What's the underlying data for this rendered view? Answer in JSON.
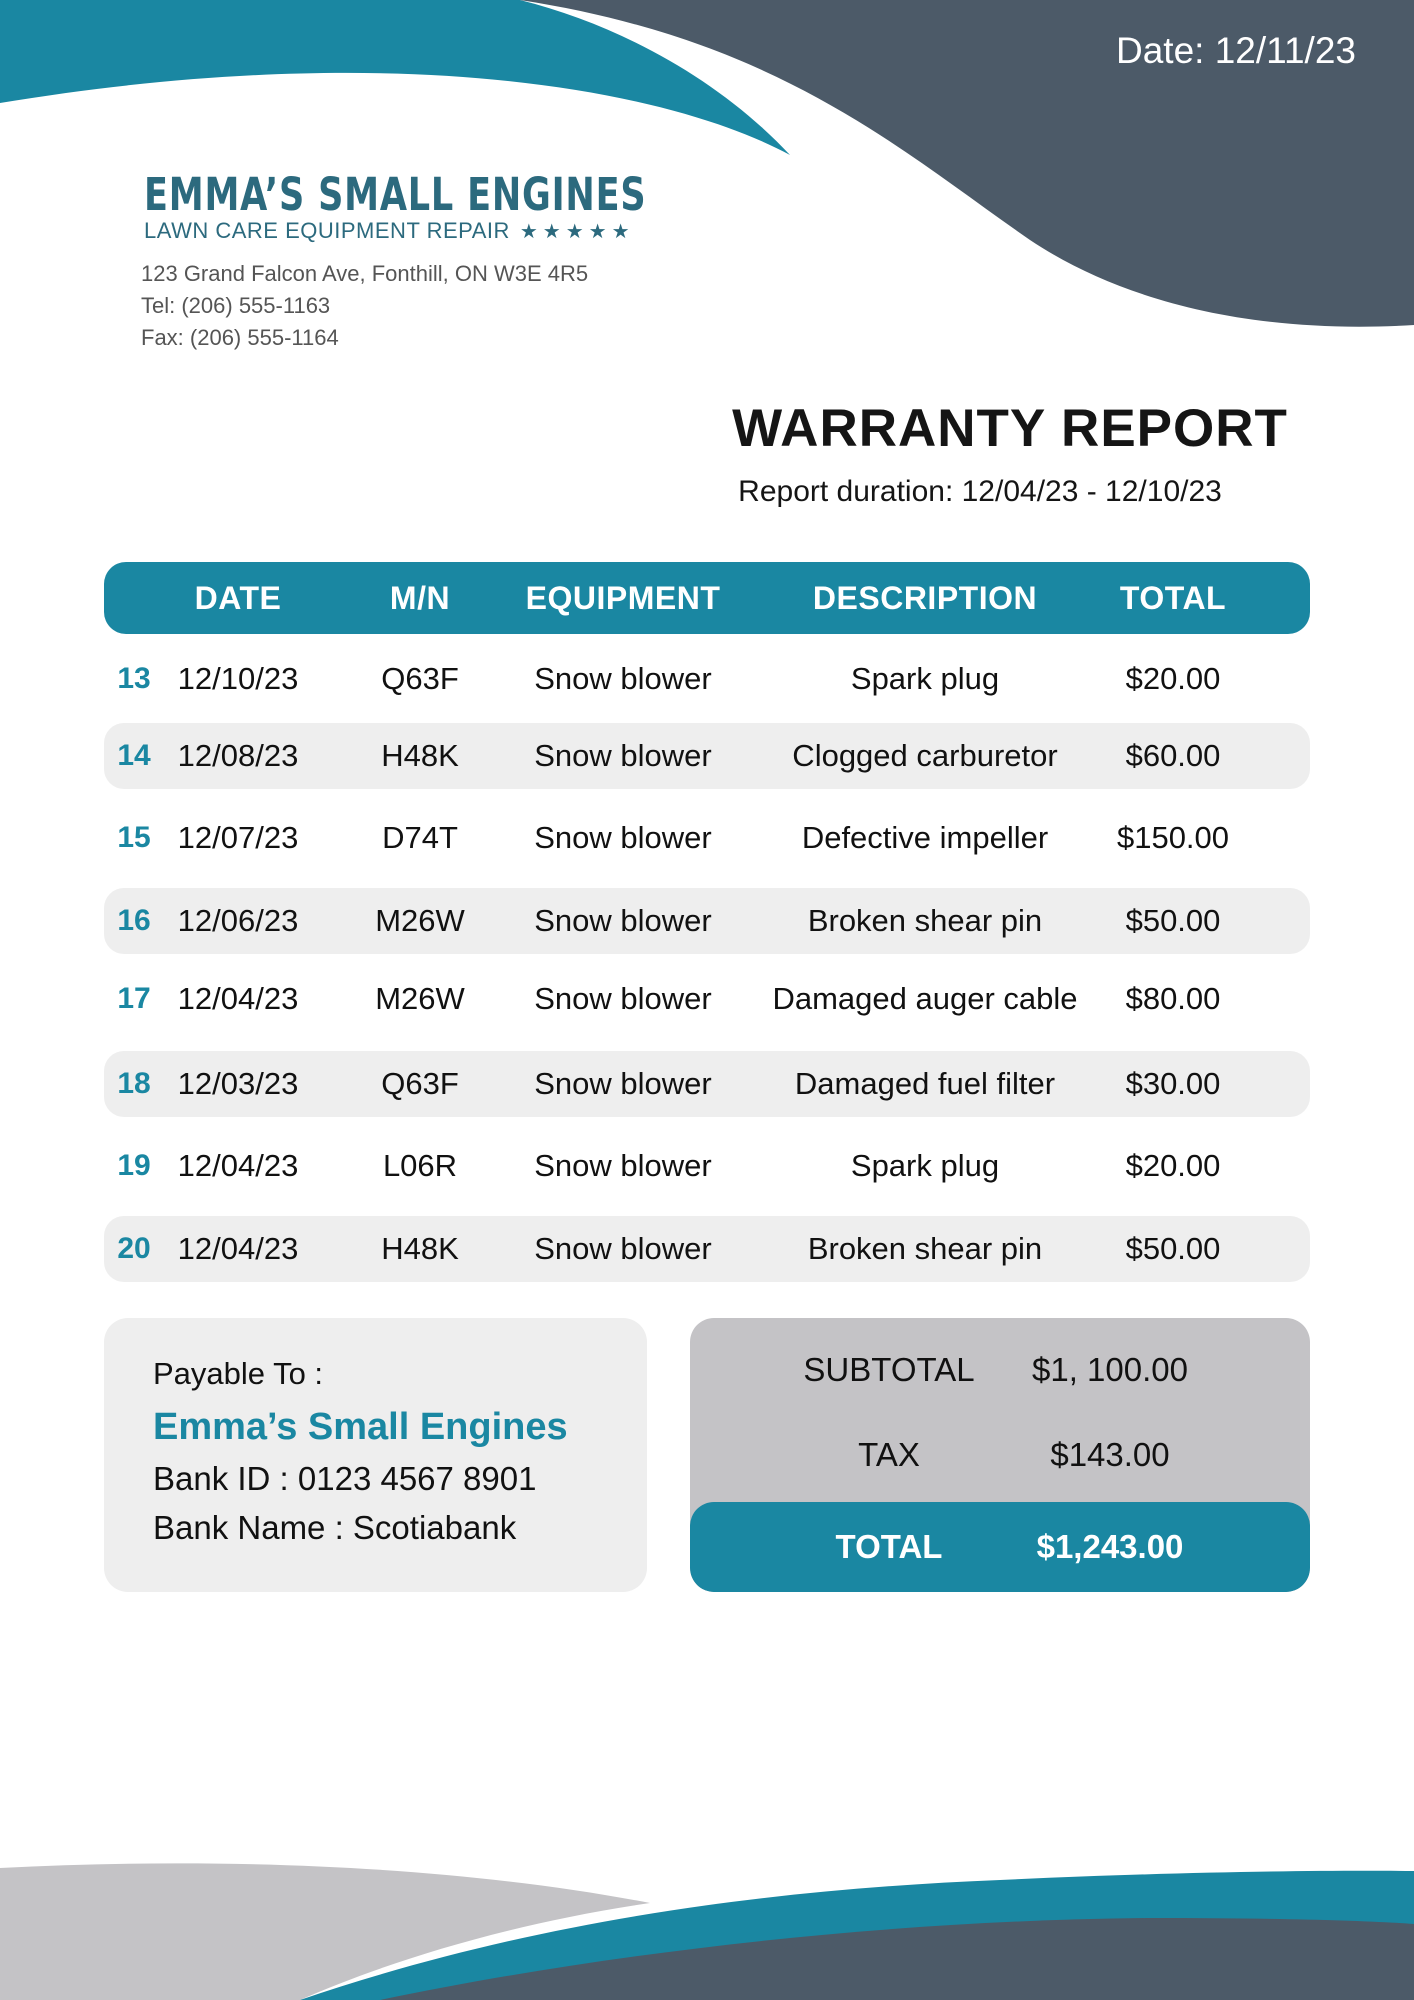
{
  "header": {
    "date": "Date: 12/11/23"
  },
  "company": {
    "logo_name": "EMMA’S SMALL ENGINES",
    "logo_tagline": "LAWN CARE EQUIPMENT REPAIR",
    "logo_stars": "★★★★★",
    "address": "123 Grand Falcon Ave, Fonthill, ON W3E 4R5",
    "tel": "Tel: (206) 555-1163",
    "fax": "Fax: (206) 555-1164"
  },
  "report": {
    "title": "WARRANTY REPORT",
    "duration": "Report duration: 12/04/23 - 12/10/23"
  },
  "table": {
    "headers": [
      "DATE",
      "M/N",
      "EQUIPMENT",
      "DESCRIPTION",
      "TOTAL"
    ],
    "rows": [
      {
        "num": "13",
        "date": "12/10/23",
        "mn": "Q63F",
        "equipment": "Snow blower",
        "description": "Spark plug",
        "total": "$20.00"
      },
      {
        "num": "14",
        "date": "12/08/23",
        "mn": "H48K",
        "equipment": "Snow blower",
        "description": "Clogged carburetor",
        "total": "$60.00"
      },
      {
        "num": "15",
        "date": "12/07/23",
        "mn": "D74T",
        "equipment": "Snow blower",
        "description": "Defective impeller",
        "total": "$150.00"
      },
      {
        "num": "16",
        "date": "12/06/23",
        "mn": "M26W",
        "equipment": "Snow blower",
        "description": "Broken shear pin",
        "total": "$50.00"
      },
      {
        "num": "17",
        "date": "12/04/23",
        "mn": "M26W",
        "equipment": "Snow blower",
        "description": "Damaged auger cable",
        "total": "$80.00"
      },
      {
        "num": "18",
        "date": "12/03/23",
        "mn": "Q63F",
        "equipment": "Snow blower",
        "description": "Damaged fuel filter",
        "total": "$30.00"
      },
      {
        "num": "19",
        "date": "12/04/23",
        "mn": "L06R",
        "equipment": "Snow blower",
        "description": "Spark plug",
        "total": "$20.00"
      },
      {
        "num": "20",
        "date": "12/04/23",
        "mn": "H48K",
        "equipment": "Snow blower",
        "description": "Broken shear pin",
        "total": "$50.00"
      }
    ]
  },
  "payable": {
    "label": "Payable To  :",
    "name": "Emma’s Small Engines",
    "bank_id": "Bank ID : 0123 4567 8901",
    "bank_name": "Bank Name : Scotiabank"
  },
  "totals": {
    "subtotal_label": "SUBTOTAL",
    "subtotal_value": "$1, 100.00",
    "tax_label": "TAX",
    "tax_value": "$143.00",
    "total_label": "TOTAL",
    "total_value": "$1,243.00"
  },
  "colors": {
    "teal": "#1a87a2",
    "slate": "#4c5a68",
    "light_gray": "#eeeeee",
    "mid_gray": "#c4c3c6"
  }
}
